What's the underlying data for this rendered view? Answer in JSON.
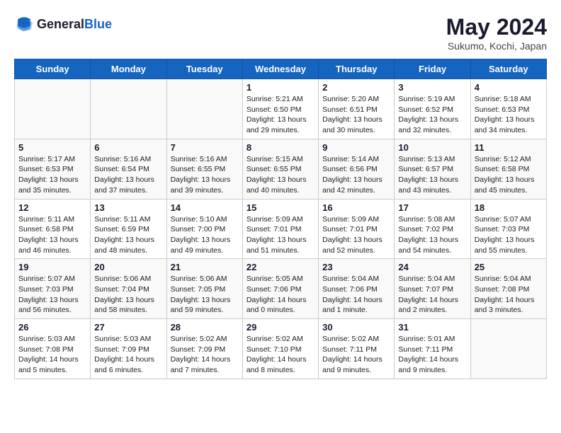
{
  "header": {
    "logo_general": "General",
    "logo_blue": "Blue",
    "month_year": "May 2024",
    "location": "Sukumo, Kochi, Japan"
  },
  "weekdays": [
    "Sunday",
    "Monday",
    "Tuesday",
    "Wednesday",
    "Thursday",
    "Friday",
    "Saturday"
  ],
  "weeks": [
    [
      {
        "day": "",
        "info": ""
      },
      {
        "day": "",
        "info": ""
      },
      {
        "day": "",
        "info": ""
      },
      {
        "day": "1",
        "info": "Sunrise: 5:21 AM\nSunset: 6:50 PM\nDaylight: 13 hours\nand 29 minutes."
      },
      {
        "day": "2",
        "info": "Sunrise: 5:20 AM\nSunset: 6:51 PM\nDaylight: 13 hours\nand 30 minutes."
      },
      {
        "day": "3",
        "info": "Sunrise: 5:19 AM\nSunset: 6:52 PM\nDaylight: 13 hours\nand 32 minutes."
      },
      {
        "day": "4",
        "info": "Sunrise: 5:18 AM\nSunset: 6:53 PM\nDaylight: 13 hours\nand 34 minutes."
      }
    ],
    [
      {
        "day": "5",
        "info": "Sunrise: 5:17 AM\nSunset: 6:53 PM\nDaylight: 13 hours\nand 35 minutes."
      },
      {
        "day": "6",
        "info": "Sunrise: 5:16 AM\nSunset: 6:54 PM\nDaylight: 13 hours\nand 37 minutes."
      },
      {
        "day": "7",
        "info": "Sunrise: 5:16 AM\nSunset: 6:55 PM\nDaylight: 13 hours\nand 39 minutes."
      },
      {
        "day": "8",
        "info": "Sunrise: 5:15 AM\nSunset: 6:55 PM\nDaylight: 13 hours\nand 40 minutes."
      },
      {
        "day": "9",
        "info": "Sunrise: 5:14 AM\nSunset: 6:56 PM\nDaylight: 13 hours\nand 42 minutes."
      },
      {
        "day": "10",
        "info": "Sunrise: 5:13 AM\nSunset: 6:57 PM\nDaylight: 13 hours\nand 43 minutes."
      },
      {
        "day": "11",
        "info": "Sunrise: 5:12 AM\nSunset: 6:58 PM\nDaylight: 13 hours\nand 45 minutes."
      }
    ],
    [
      {
        "day": "12",
        "info": "Sunrise: 5:11 AM\nSunset: 6:58 PM\nDaylight: 13 hours\nand 46 minutes."
      },
      {
        "day": "13",
        "info": "Sunrise: 5:11 AM\nSunset: 6:59 PM\nDaylight: 13 hours\nand 48 minutes."
      },
      {
        "day": "14",
        "info": "Sunrise: 5:10 AM\nSunset: 7:00 PM\nDaylight: 13 hours\nand 49 minutes."
      },
      {
        "day": "15",
        "info": "Sunrise: 5:09 AM\nSunset: 7:01 PM\nDaylight: 13 hours\nand 51 minutes."
      },
      {
        "day": "16",
        "info": "Sunrise: 5:09 AM\nSunset: 7:01 PM\nDaylight: 13 hours\nand 52 minutes."
      },
      {
        "day": "17",
        "info": "Sunrise: 5:08 AM\nSunset: 7:02 PM\nDaylight: 13 hours\nand 54 minutes."
      },
      {
        "day": "18",
        "info": "Sunrise: 5:07 AM\nSunset: 7:03 PM\nDaylight: 13 hours\nand 55 minutes."
      }
    ],
    [
      {
        "day": "19",
        "info": "Sunrise: 5:07 AM\nSunset: 7:03 PM\nDaylight: 13 hours\nand 56 minutes."
      },
      {
        "day": "20",
        "info": "Sunrise: 5:06 AM\nSunset: 7:04 PM\nDaylight: 13 hours\nand 58 minutes."
      },
      {
        "day": "21",
        "info": "Sunrise: 5:06 AM\nSunset: 7:05 PM\nDaylight: 13 hours\nand 59 minutes."
      },
      {
        "day": "22",
        "info": "Sunrise: 5:05 AM\nSunset: 7:06 PM\nDaylight: 14 hours\nand 0 minutes."
      },
      {
        "day": "23",
        "info": "Sunrise: 5:04 AM\nSunset: 7:06 PM\nDaylight: 14 hours\nand 1 minute."
      },
      {
        "day": "24",
        "info": "Sunrise: 5:04 AM\nSunset: 7:07 PM\nDaylight: 14 hours\nand 2 minutes."
      },
      {
        "day": "25",
        "info": "Sunrise: 5:04 AM\nSunset: 7:08 PM\nDaylight: 14 hours\nand 3 minutes."
      }
    ],
    [
      {
        "day": "26",
        "info": "Sunrise: 5:03 AM\nSunset: 7:08 PM\nDaylight: 14 hours\nand 5 minutes."
      },
      {
        "day": "27",
        "info": "Sunrise: 5:03 AM\nSunset: 7:09 PM\nDaylight: 14 hours\nand 6 minutes."
      },
      {
        "day": "28",
        "info": "Sunrise: 5:02 AM\nSunset: 7:09 PM\nDaylight: 14 hours\nand 7 minutes."
      },
      {
        "day": "29",
        "info": "Sunrise: 5:02 AM\nSunset: 7:10 PM\nDaylight: 14 hours\nand 8 minutes."
      },
      {
        "day": "30",
        "info": "Sunrise: 5:02 AM\nSunset: 7:11 PM\nDaylight: 14 hours\nand 9 minutes."
      },
      {
        "day": "31",
        "info": "Sunrise: 5:01 AM\nSunset: 7:11 PM\nDaylight: 14 hours\nand 9 minutes."
      },
      {
        "day": "",
        "info": ""
      }
    ]
  ]
}
